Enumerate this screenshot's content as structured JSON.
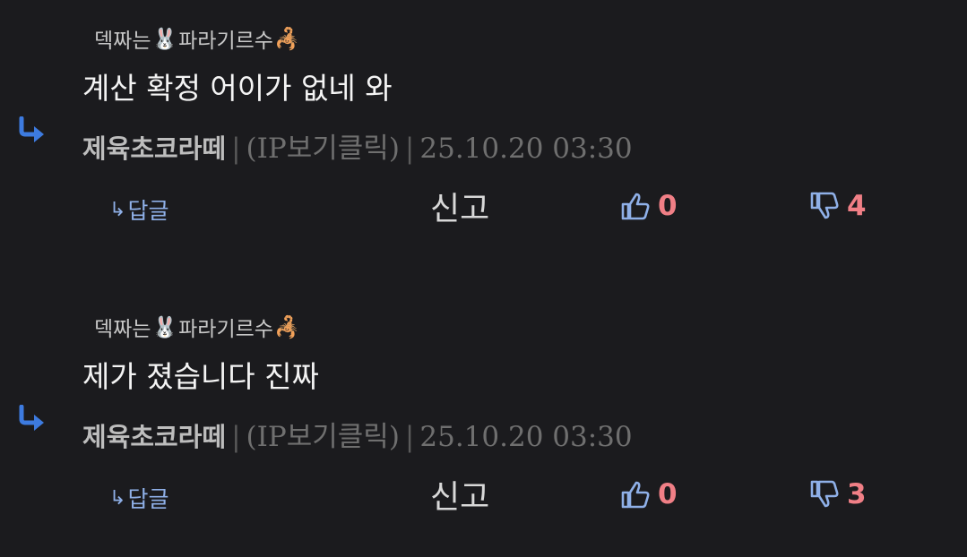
{
  "comments": [
    {
      "quote_author_prefix": "덱짜는",
      "quote_author_suffix": "파라기르수",
      "quote_author_emoji_1": "🐰",
      "quote_author_emoji_2": "🦂",
      "quote_text": "계산 확정 어이가 없네 와",
      "nickname": "제육초코라떼",
      "ip_label": "(IP보기클릭)",
      "timestamp": "25.10.20 03:30",
      "reply_label": "답글",
      "report_label": "신고",
      "likes": "0",
      "dislikes": "4"
    },
    {
      "quote_author_prefix": "덱짜는",
      "quote_author_suffix": "파라기르수",
      "quote_author_emoji_1": "🐰",
      "quote_author_emoji_2": "🦂",
      "quote_text": "제가 졌습니다 진짜",
      "nickname": "제육초코라떼",
      "ip_label": "(IP보기클릭)",
      "timestamp": "25.10.20 03:30",
      "reply_label": "답글",
      "report_label": "신고",
      "likes": "0",
      "dislikes": "3"
    }
  ],
  "colors": {
    "background": "#1b1b1e",
    "reply_arrow": "#3d7be0",
    "reply_link": "#8fb0e8",
    "vote_count": "#f07f86",
    "thumb_icon": "#8fb0e8"
  },
  "icons": [
    "reply-arrow-icon",
    "thumbs-up-icon",
    "thumbs-down-icon",
    "rabbit-emoji-icon",
    "scorpion-emoji-icon"
  ]
}
